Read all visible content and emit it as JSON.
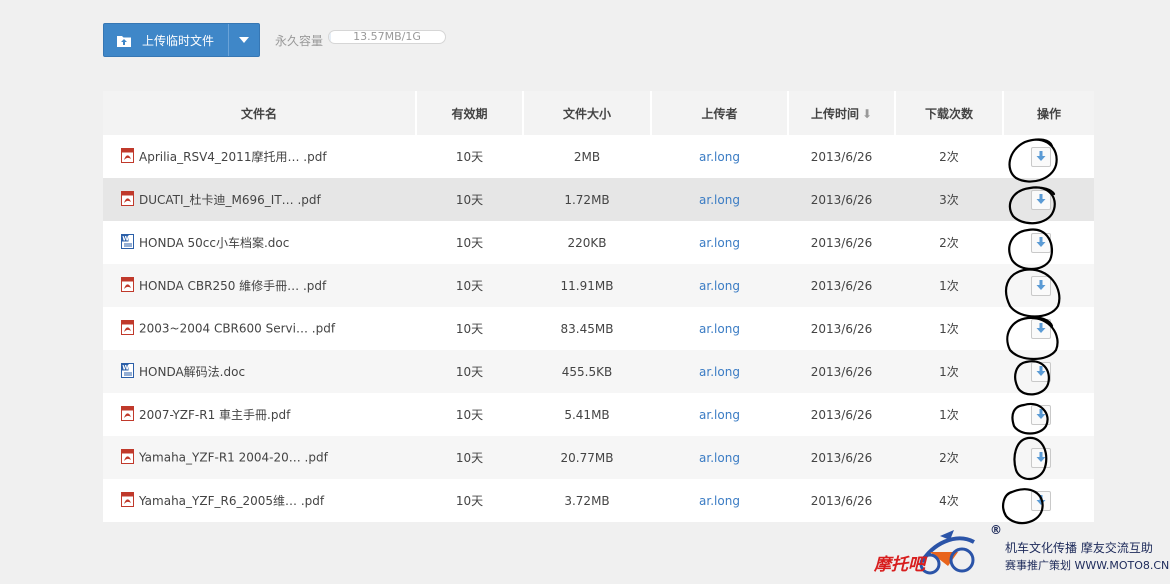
{
  "toolbar": {
    "upload_label": "上传临时文件",
    "quota_label": "永久容量",
    "quota_text": "13.57MB/1G",
    "quota_fraction": 0.0133
  },
  "table": {
    "headers": {
      "name": "文件名",
      "validity": "有效期",
      "size": "文件大小",
      "uploader": "上传者",
      "upload_time": "上传时间",
      "sort_indicator": "⬇",
      "downloads": "下载次数",
      "actions": "操作"
    },
    "rows": [
      {
        "type": "pdf",
        "name": "Aprilia_RSV4_2011摩托用… .pdf",
        "validity": "10天",
        "size": "2MB",
        "uploader": "ar.long",
        "time": "2013/6/26",
        "downloads": "2次"
      },
      {
        "type": "pdf",
        "name": "DUCATI_杜卡迪_M696_IT… .pdf",
        "validity": "10天",
        "size": "1.72MB",
        "uploader": "ar.long",
        "time": "2013/6/26",
        "downloads": "3次"
      },
      {
        "type": "doc",
        "name": "HONDA 50cc小车档案.doc",
        "validity": "10天",
        "size": "220KB",
        "uploader": "ar.long",
        "time": "2013/6/26",
        "downloads": "2次"
      },
      {
        "type": "pdf",
        "name": "HONDA CBR250 維修手冊… .pdf",
        "validity": "10天",
        "size": "11.91MB",
        "uploader": "ar.long",
        "time": "2013/6/26",
        "downloads": "1次"
      },
      {
        "type": "pdf",
        "name": "2003~2004 CBR600 Servi… .pdf",
        "validity": "10天",
        "size": "83.45MB",
        "uploader": "ar.long",
        "time": "2013/6/26",
        "downloads": "1次"
      },
      {
        "type": "doc",
        "name": "HONDA解码法.doc",
        "validity": "10天",
        "size": "455.5KB",
        "uploader": "ar.long",
        "time": "2013/6/26",
        "downloads": "1次"
      },
      {
        "type": "pdf",
        "name": "2007-YZF-R1 車主手冊.pdf",
        "validity": "10天",
        "size": "5.41MB",
        "uploader": "ar.long",
        "time": "2013/6/26",
        "downloads": "1次"
      },
      {
        "type": "pdf",
        "name": "Yamaha_YZF-R1 2004-20… .pdf",
        "validity": "10天",
        "size": "20.77MB",
        "uploader": "ar.long",
        "time": "2013/6/26",
        "downloads": "2次"
      },
      {
        "type": "pdf",
        "name": "Yamaha_YZF_R6_2005维… .pdf",
        "validity": "10天",
        "size": "3.72MB",
        "uploader": "ar.long",
        "time": "2013/6/26",
        "downloads": "4次"
      }
    ]
  },
  "watermark": {
    "brand": "摩托吧",
    "registered": "®",
    "line1": "机车文化传播  摩友交流互助",
    "line2": "赛事推广策划  WWW.MOTO8.CN"
  },
  "colors": {
    "accent": "#3f87c8",
    "link": "#3b7cc4",
    "pdf_icon": "#c0392b",
    "doc_icon": "#2b5fa8"
  }
}
